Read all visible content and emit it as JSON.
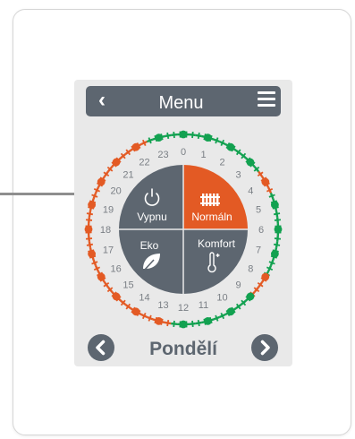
{
  "header": {
    "title": "Menu",
    "back_icon": "chevron-left-icon",
    "menu_icon": "hamburger-menu-icon"
  },
  "dial": {
    "hours": [
      "0",
      "1",
      "2",
      "3",
      "4",
      "5",
      "6",
      "7",
      "8",
      "9",
      "10",
      "11",
      "12",
      "13",
      "14",
      "15",
      "16",
      "17",
      "18",
      "19",
      "20",
      "21",
      "22",
      "23"
    ],
    "schedule": {
      "comfort_color": "#e35a24",
      "eco_color": "#12a150",
      "half_hour_modes": [
        "eco",
        "eco",
        "eco",
        "eco",
        "eco",
        "eco",
        "eco",
        "eco",
        "eco",
        "eco",
        "eco",
        "eco",
        "eco",
        "eco",
        "comfort",
        "comfort",
        "comfort",
        "comfort",
        "eco",
        "eco",
        "eco",
        "eco",
        "eco",
        "eco",
        "eco",
        "eco",
        "eco",
        "eco",
        "eco",
        "eco",
        "eco",
        "eco",
        "comfort",
        "comfort",
        "comfort",
        "comfort",
        "eco",
        "eco",
        "eco",
        "eco",
        "eco",
        "eco",
        "eco",
        "eco",
        "eco",
        "eco",
        "eco",
        "eco",
        "eco",
        "eco",
        "comfort",
        "comfort",
        "comfort",
        "comfort",
        "comfort",
        "comfort",
        "comfort",
        "comfort",
        "comfort",
        "comfort",
        "comfort",
        "comfort",
        "comfort",
        "comfort",
        "comfort",
        "comfort",
        "comfort",
        "comfort",
        "comfort",
        "comfort",
        "comfort",
        "comfort",
        "comfort",
        "comfort",
        "comfort",
        "comfort",
        "comfort",
        "comfort",
        "comfort",
        "comfort",
        "comfort",
        "comfort",
        "comfort",
        "comfort",
        "comfort",
        "comfort",
        "comfort",
        "comfort",
        "comfort",
        "comfort",
        "eco",
        "eco",
        "eco",
        "eco",
        "eco",
        "eco"
      ]
    },
    "modes": {
      "off": {
        "label": "Vypnu",
        "icon": "power-icon"
      },
      "normal": {
        "label": "Normáln",
        "icon": "radiator-icon",
        "active": true
      },
      "eco": {
        "label": "Eko",
        "icon": "leaf-icon"
      },
      "comfort": {
        "label": "Komfort",
        "icon": "thermometer-plus-icon"
      }
    }
  },
  "footer": {
    "day": "Pondělí",
    "prev_icon": "chevron-left-circle-icon",
    "next_icon": "chevron-right-circle-icon"
  },
  "colors": {
    "panel": "#5d6670",
    "active": "#e35a24",
    "device_bg": "#e9e9e9"
  }
}
